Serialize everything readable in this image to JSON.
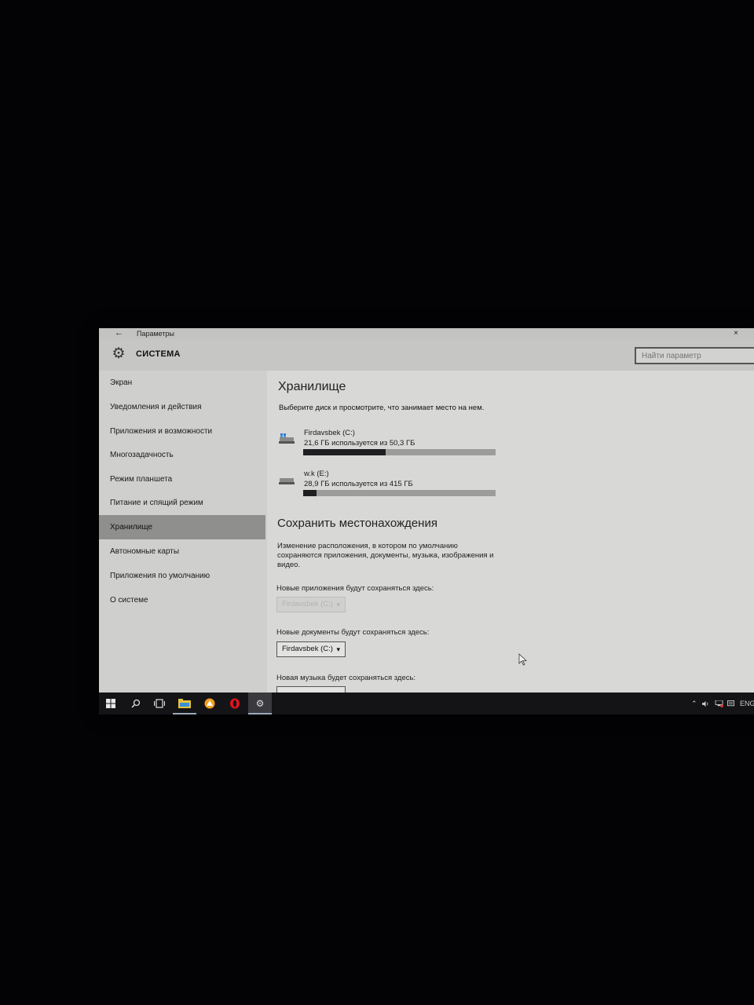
{
  "window": {
    "back_glyph": "←",
    "title": "Параметры",
    "close_glyph": "×"
  },
  "header": {
    "section": "СИСТЕМА",
    "search_placeholder": "Найти параметр"
  },
  "sidebar": {
    "items": [
      {
        "label": "Экран",
        "active": false
      },
      {
        "label": "Уведомления и действия",
        "active": false
      },
      {
        "label": "Приложения и возможности",
        "active": false
      },
      {
        "label": "Многозадачность",
        "active": false
      },
      {
        "label": "Режим планшета",
        "active": false
      },
      {
        "label": "Питание и спящий режим",
        "active": false
      },
      {
        "label": "Хранилище",
        "active": true
      },
      {
        "label": "Автономные карты",
        "active": false
      },
      {
        "label": "Приложения по умолчанию",
        "active": false
      },
      {
        "label": "О системе",
        "active": false
      }
    ]
  },
  "storage": {
    "title": "Хранилище",
    "subtitle": "Выберите диск и просмотрите, что занимает место на нем.",
    "drives": [
      {
        "name": "Firdavsbek (C:)",
        "usage": "21,6 ГБ используется из 50,3 ГБ",
        "used_gb": 21.6,
        "total_gb": 50.3,
        "icon": "windows-drive-icon"
      },
      {
        "name": "w.k (E:)",
        "usage": "28,9 ГБ используется из 415 ГБ",
        "used_gb": 28.9,
        "total_gb": 415,
        "icon": "drive-icon"
      }
    ]
  },
  "save_locations": {
    "title": "Сохранить местонахождения",
    "description": "Изменение расположения, в котором по умолчанию сохраняются приложения, документы, музыка, изображения и видео.",
    "apps_label": "Новые приложения будут сохраняться здесь:",
    "apps_value": "Firdavsbek (C:)",
    "docs_label": "Новые документы будут сохраняться здесь:",
    "docs_value": "Firdavsbek (C:)",
    "music_label": "Новая музыка будет сохраняться здесь:"
  },
  "taskbar": {
    "language": "ENG"
  },
  "colors": {
    "bar_fill": "#1f1f22",
    "bar_track": "#9c9c9a",
    "active_nav": "#8f8f8e"
  }
}
